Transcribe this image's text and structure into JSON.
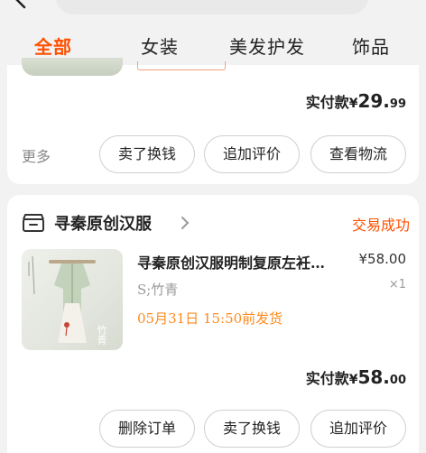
{
  "tabs": [
    "全部",
    "女装",
    "美发护发",
    "饰品"
  ],
  "order1": {
    "tag_text": "",
    "pay_label": "实付款",
    "currency": "¥",
    "pay_int": "29.",
    "pay_dec": "99",
    "more_label": "更多",
    "actions": [
      "卖了换钱",
      "追加评价",
      "查看物流"
    ]
  },
  "order2": {
    "shop_name": "寻秦原创汉服",
    "status": "交易成功",
    "product_title": "寻秦原创汉服明制复原左衽…",
    "price": "¥58.00",
    "quantity": "×1",
    "sku": "S;竹青",
    "ship_note": "05月31日 15:50前发货",
    "image_caption": "竹青",
    "pay_label": "实付款",
    "currency": "¥",
    "pay_int": "58.",
    "pay_dec": "00",
    "actions": [
      "删除订单",
      "卖了换钱",
      "追加评价"
    ]
  },
  "colors": {
    "accent": "#ff5000",
    "ship_note": "#ff8a1c"
  }
}
